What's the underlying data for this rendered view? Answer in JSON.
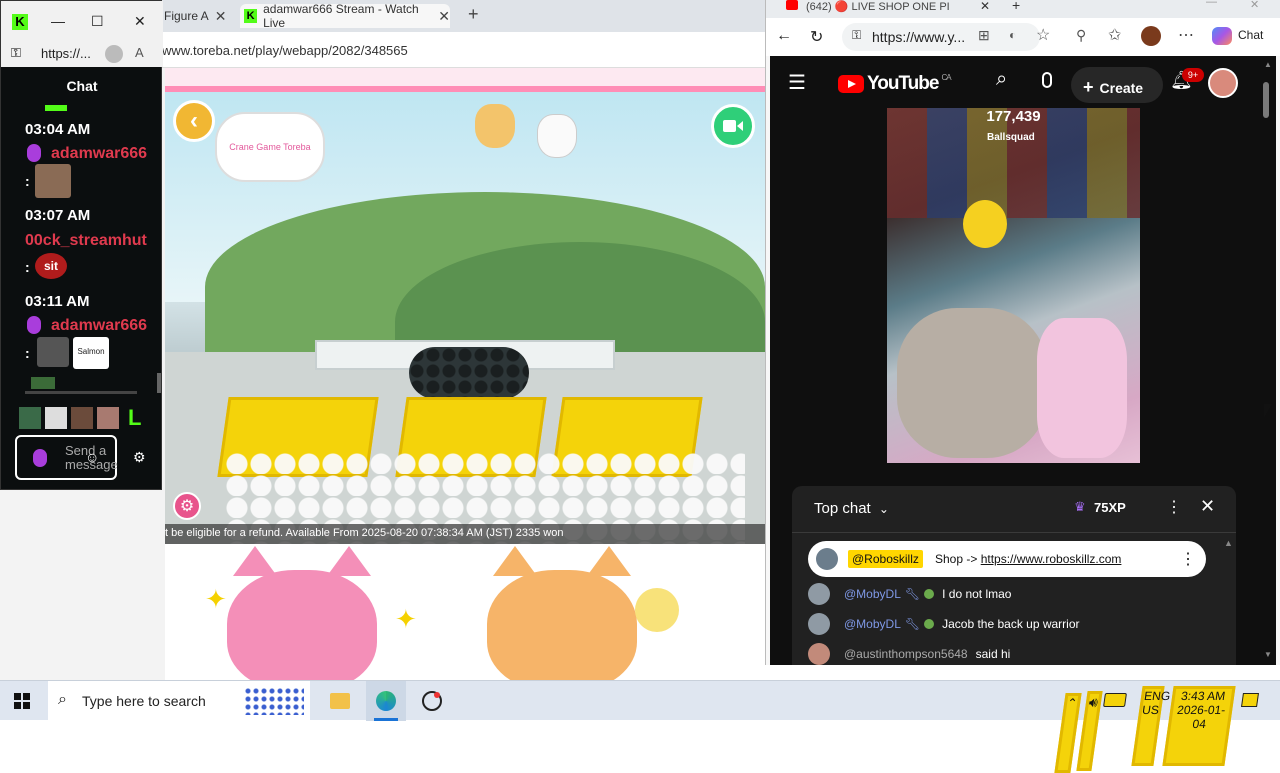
{
  "bg_browser": {
    "tabs": [
      {
        "label": "Figure A",
        "close": "✕"
      },
      {
        "label": "adamwar666 Stream - Watch Live",
        "close": "✕"
      }
    ],
    "new_tab": "+",
    "url": "www.toreba.net/play/webapp/2082/348565",
    "game": {
      "ticker": "t be eligible for a refund. Available From 2025-08-20 07:38:34 AM (JST) 2335 won",
      "sign_text": "Crane Game Toreba",
      "back_icon": "chevron-left-icon",
      "video_icon": "camera-switch-icon",
      "settings_icon": "gear-icon"
    }
  },
  "kick_popup": {
    "url": "https://...",
    "header": "Chat",
    "messages": [
      {
        "time": "03:04 AM",
        "user": "adamwar666",
        "colon": ":"
      },
      {
        "time": "03:07 AM",
        "user": "00ck_streamhut",
        "colon": ":",
        "text": "sit"
      },
      {
        "time": "03:11 AM",
        "user": "adamwar666",
        "colon": ":",
        "sticker": "Salmon"
      }
    ],
    "emote_bar_extra": "L",
    "input_placeholder": "Send a message",
    "accent": "#53fc18",
    "username_color": "#e03a4e"
  },
  "youtube": {
    "tab_label": "(642) 🔴 LIVE SHOP ONE PI",
    "url": "https://www.y...",
    "copilot_label": "Chat",
    "logo_text": "YouTube",
    "logo_region": "CA",
    "create_label": "Create",
    "notif_badge": "9+",
    "video": {
      "viewer_count": "177,439",
      "tag": "Ballsquad"
    },
    "chat": {
      "mode": "Top chat",
      "xp": "75XP",
      "pinned": {
        "user": "@Roboskillz",
        "prefix": "Shop -> ",
        "link": "https://www.roboskillz.com"
      },
      "messages": [
        {
          "user": "@MobyDL",
          "text": "I do not lmao"
        },
        {
          "user": "@MobyDL",
          "text": "Jacob the back up warrior"
        },
        {
          "user": "@austinthompson5648",
          "text": "said hi"
        }
      ]
    },
    "brand_color": "#ff0000"
  },
  "taskbar": {
    "search_placeholder": "Type here to search",
    "lang_1": "ENG",
    "lang_2": "US",
    "time": "3:43 AM",
    "date": "2026-01-04"
  }
}
